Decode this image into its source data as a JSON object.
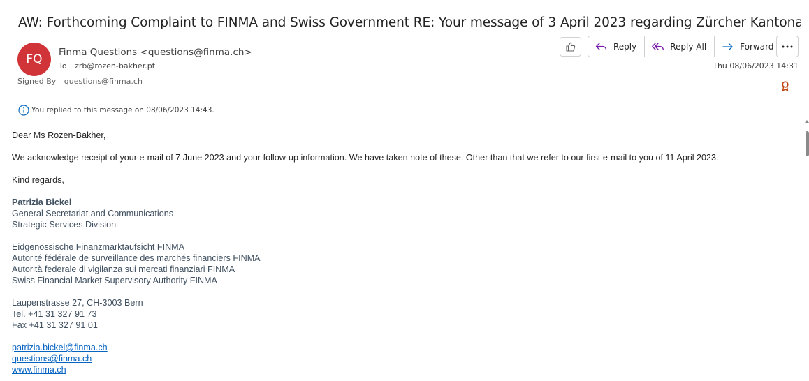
{
  "email": {
    "subject": "AW: Forthcoming Complaint to FINMA and Swiss Government RE: Your message of 3 April 2023 regarding Zürcher Kantonalbank (Z...",
    "avatar_initials": "FQ",
    "avatar_color": "#d13438",
    "sender": "Finma Questions <questions@finma.ch>",
    "to_label": "To",
    "to_value": "zrb@rozen-bakher.pt",
    "signed_label": "Signed By",
    "signed_value": "questions@finma.ch",
    "date": "Thu 08/06/2023 14:31",
    "reply_info": "You replied to this message on 08/06/2023 14:43."
  },
  "toolbar": {
    "like_icon": "thumbs-up-icon",
    "reply_label": "Reply",
    "reply_all_label": "Reply All",
    "forward_label": "Forward",
    "more_icon": "more-options-icon"
  },
  "body": {
    "greeting": "Dear Ms Rozen-Bakher,",
    "paragraph": "We acknowledge receipt of your e-mail of 7 June 2023 and your follow-up information. We have taken note of these. Other than that we refer to our first e-mail to you of 11 April 2023.",
    "closing": "Kind regards,",
    "signature": {
      "name": "Patrizia Bickel",
      "title1": "General Secretariat and Communications",
      "title2": "Strategic Services Division",
      "org1": "Eidgenössische Finanzmarktaufsicht FINMA",
      "org2": "Autorité fédérale de surveillance des marchés financiers FINMA",
      "org3": "Autorità federale di vigilanza sui mercati finanziari FINMA",
      "org4": "Swiss Financial Market Supervisory Authority FINMA",
      "address": "Laupenstrasse 27, CH-3003 Bern",
      "tel": "Tel. +41 31 327 91 73",
      "fax": "Fax +41 31 327 91 01",
      "email_link": "patrizia.bickel@finma.ch",
      "questions_link": "questions@finma.ch",
      "web_link": "www.finma.ch"
    }
  },
  "colors": {
    "accent": "#0f6cbd",
    "link": "#0563c1",
    "signature_text": "#3f4f5f",
    "certificate": "#c2410c"
  }
}
